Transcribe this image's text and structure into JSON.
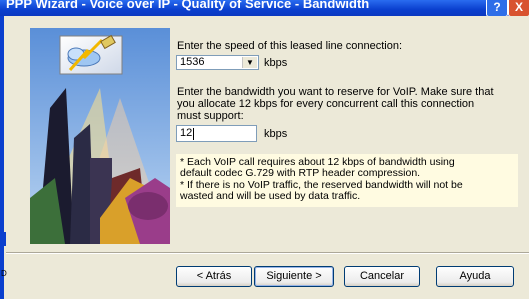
{
  "window": {
    "title": "PPP Wizard - Voice over IP - Quality of Service - Bandwidth",
    "help_label": "?",
    "close_label": "X"
  },
  "speed": {
    "label": "Enter the speed of this leased line connection:",
    "value": "1536",
    "unit": "kbps"
  },
  "bandwidth": {
    "label_lines": [
      "Enter the bandwidth you want to reserve for VoIP. Make sure that",
      "you allocate 12 kbps for every concurrent call this connection",
      "must support:"
    ],
    "value": "12",
    "unit": "kbps"
  },
  "notes": {
    "lines": [
      "*  Each VoIP call requires about 12 kbps of bandwidth using",
      "   default codec G.729 with RTP header compression.",
      "*  If there is no VoIP traffic, the reserved bandwidth will not be",
      "   wasted and will be used by data traffic."
    ]
  },
  "buttons": {
    "back": "< Atrás",
    "next": "Siguiente >",
    "cancel": "Cancelar",
    "help": "Ayuda"
  },
  "edge_text": "D"
}
